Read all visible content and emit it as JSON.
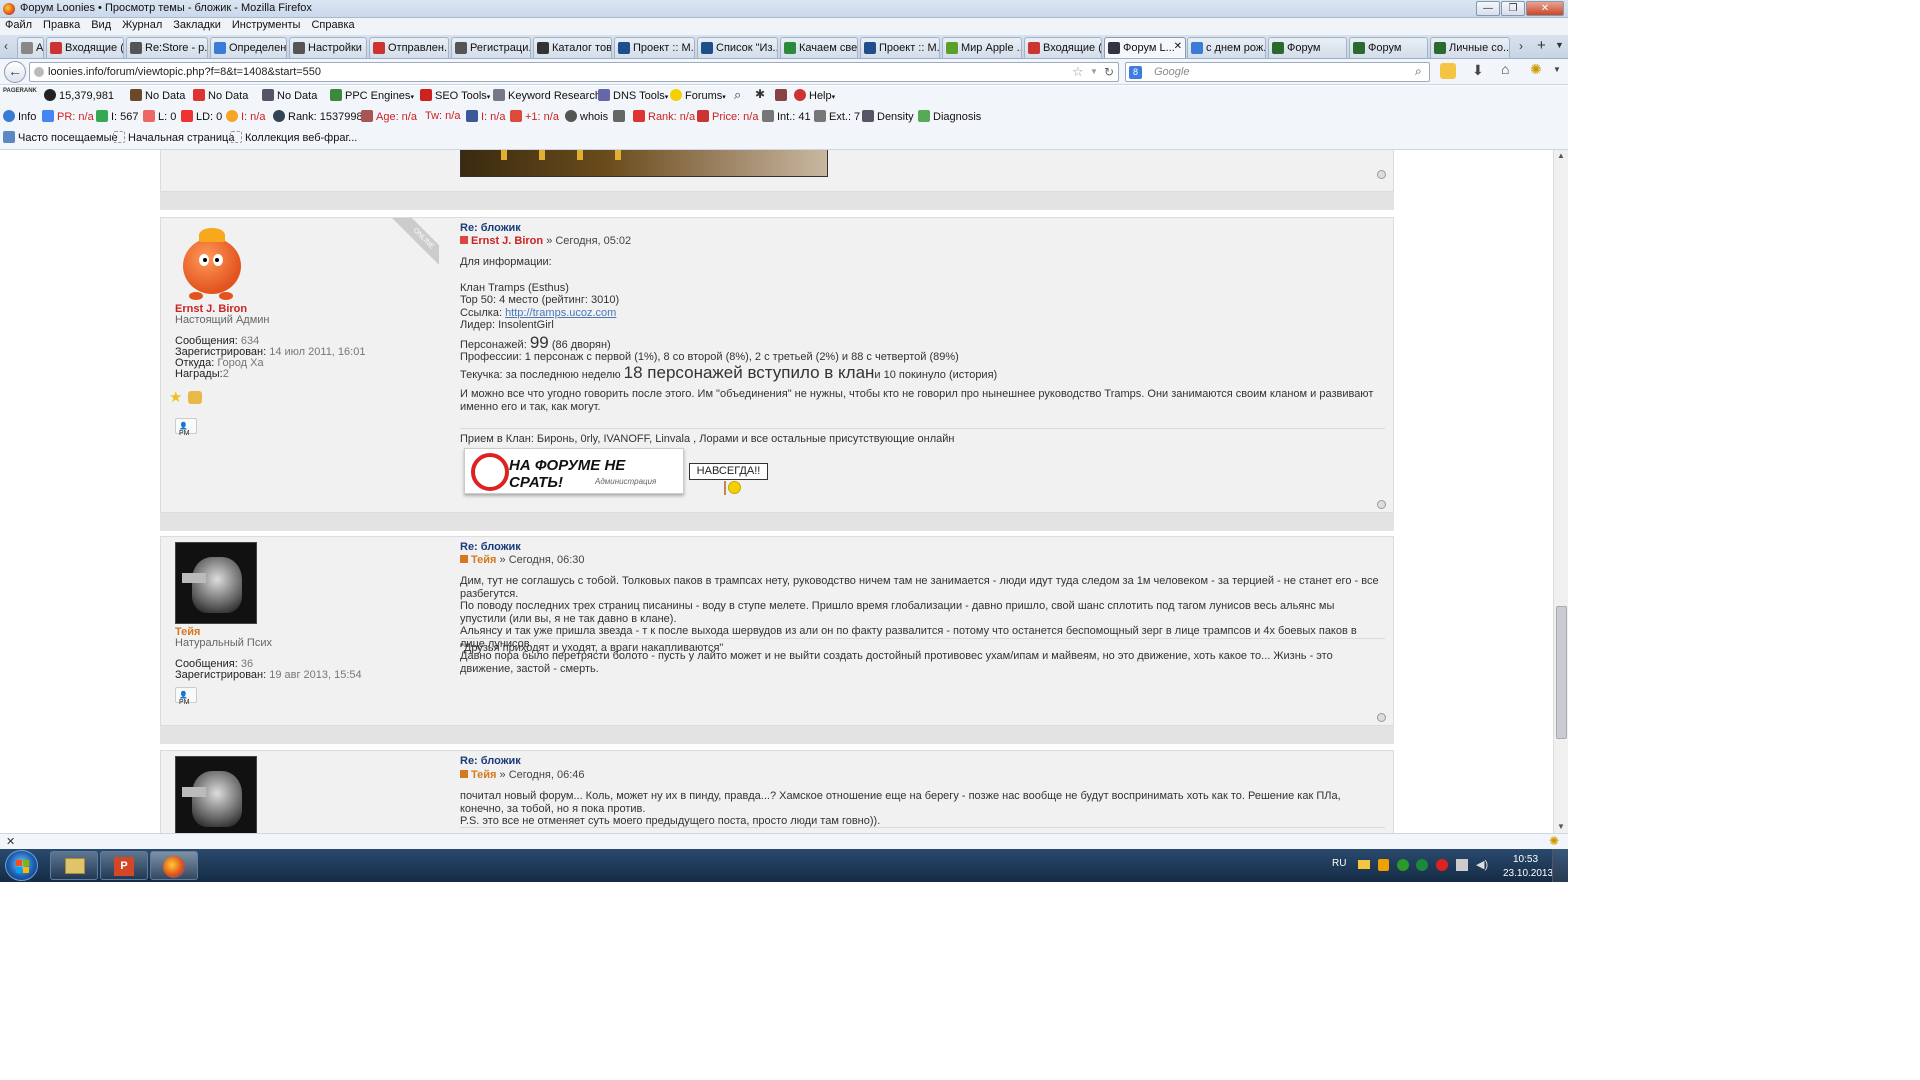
{
  "window": {
    "title": "Форум Loonies • Просмотр темы - бложик - Mozilla Firefox"
  },
  "menu": [
    "Файл",
    "Правка",
    "Вид",
    "Журнал",
    "Закладки",
    "Инструменты",
    "Справка"
  ],
  "tabs": [
    {
      "label": "Ad...",
      "icon_color": "#888"
    },
    {
      "label": "Входящие (...",
      "icon_color": "#c33"
    },
    {
      "label": "Re:Store - р...",
      "icon_color": "#555"
    },
    {
      "label": "Определен...",
      "icon_color": "#3a7bd5"
    },
    {
      "label": "Настройки ...",
      "icon_color": "#555"
    },
    {
      "label": "Отправлен...",
      "icon_color": "#c33"
    },
    {
      "label": "Регистраци...",
      "icon_color": "#555"
    },
    {
      "label": "Каталог тов...",
      "icon_color": "#333"
    },
    {
      "label": "Проект :: М...",
      "icon_color": "#1f4e8c"
    },
    {
      "label": "Список \"Из...",
      "icon_color": "#1f4e8c"
    },
    {
      "label": "Качаем све...",
      "icon_color": "#2b8a3e"
    },
    {
      "label": "Проект :: М...",
      "icon_color": "#1f4e8c"
    },
    {
      "label": "Мир Apple ...",
      "icon_color": "#5aa02c"
    },
    {
      "label": "Входящие (...",
      "icon_color": "#c33"
    },
    {
      "label": "Форум L...",
      "icon_color": "#334",
      "active": true
    },
    {
      "label": "с днем рож...",
      "icon_color": "#3a7bd5"
    },
    {
      "label": "Форум",
      "icon_color": "#2b6a2e"
    },
    {
      "label": "Форум",
      "icon_color": "#2b6a2e"
    },
    {
      "label": "Личные со...",
      "icon_color": "#2b6a2e"
    }
  ],
  "nav": {
    "url": "loonies.info/forum/viewtopic.php?f=8&t=1408&start=550",
    "search_placeholder": "Google"
  },
  "toolbar1": {
    "pagerank": "PAGERANK",
    "alexa": "15,379,981",
    "nodata1": "No Data",
    "nodata2": "No Data",
    "nodata3": "No Data",
    "ppc": "PPC Engines",
    "seo": "SEO Tools",
    "keyword": "Keyword Research",
    "dns": "DNS Tools",
    "forums": "Forums",
    "help": "Help"
  },
  "toolbar2": {
    "info": "Info",
    "pr": "PR: n/a",
    "i567": "I: 567",
    "l0": "L: 0",
    "ld0": "LD: 0",
    "ina": "I: n/a",
    "rank": "Rank: 15379981",
    "age": "Age: n/a",
    "tw": "Tw: n/a",
    "fb": "I: n/a",
    "gplus": "+1: n/a",
    "whois": "whois",
    "rank2": "Rank: n/a",
    "price": "Price: n/a",
    "int": "Int.: 41",
    "ext": "Ext.: 7",
    "density": "Density",
    "diagnosis": "Diagnosis"
  },
  "bookmarks": [
    "Часто посещаемые",
    "Начальная страница",
    "Коллекция веб-фраг..."
  ],
  "posts": [
    {
      "title": "Re: бложик",
      "author": "Ernst J. Biron",
      "date": "» Сегодня, 05:02",
      "online_badge": "ONLINE",
      "user_rank": "Настоящий Админ",
      "info": {
        "posts_label": "Сообщения:",
        "posts": "634",
        "reg_label": "Зарегистрирован:",
        "reg": "14 июл 2011, 16:01",
        "from_label": "Откуда:",
        "from": "Город Ха",
        "awards_label": "Награды:",
        "awards": "2"
      },
      "pm": "PM",
      "body": {
        "l1": "Для информации:",
        "l2": "Клан Tramps (Esthus)",
        "l3": "Top 50: 4 место (рейтинг: 3010)",
        "l4_label": "Ссылка:",
        "l4_link": "http://tramps.ucoz.com",
        "l5": "Лидер: InsolentGirl",
        "l6_label": "Персонажей:",
        "l6_big": "99",
        "l6_tail": "(86 дворян)",
        "l7": "Профессии: 1 персонаж с первой (1%), 8 со второй (8%), 2 с третьей (2%) и 88 с четвертой (89%)",
        "l8_label": "Текучка: за последнюю неделю",
        "l8_big": "18 персонажей вступило в клан",
        "l8_tail": "и 10 покинуло (история)",
        "l9": "И можно все что угодно говорить после этого. Им \"объединения\" не нужны, чтобы кто не говорил про нынешнее руководство Tramps. Они занимаются своим кланом и развивают именно его и так, как могут.",
        "sig": "Прием в Клан: Биронь, 0rly, IVANOFF, Linvala , Лорами и все остальные присутствующие онлайн",
        "banner": "НА ФОРУМЕ НЕ СРАТЬ!",
        "banner_sub": "Администрация",
        "sign": "НАВСЕГДА!!"
      }
    },
    {
      "title": "Re: бложик",
      "author": "Тейя",
      "date": "» Сегодня, 06:30",
      "user_rank": "Натуральный Псих",
      "info": {
        "posts_label": "Сообщения:",
        "posts": "36",
        "reg_label": "Зарегистрирован:",
        "reg": "19 авг 2013, 15:54"
      },
      "pm": "PM",
      "body": {
        "l1": "Дим, тут не соглашусь с тобой. Толковых паков в трампсах нету, руководство ничем там не занимается - люди идут туда следом за 1м человеком - за терцией - не станет его - все разбегутся.",
        "l2": "По поводу последних трех страниц писанины - воду в ступе мелете. Пришло время глобализации - давно пришло, свой шанс сплотить под тагом лунисов весь альянс мы упустили (или вы, я не так давно в клане).",
        "l3": "Альянсу и так уже пришла звезда - т к после выхода шервудов из али он по факту развалится - потому что останется беспомощный зерг в лице трампсов и 4х боевых паков в лице лунисов.",
        "l4": "Давно пора было перетрясти болото - пусть у лайто может и не выйти создать достойный противовес ухам/ипам и майвеям, но это движение, хоть какое то... Жизнь - это движение, застой - смерть.",
        "sig": "\"Друзья приходят и уходят, а враги накапливаются\""
      }
    },
    {
      "title": "Re: бложик",
      "author": "Тейя",
      "date": "» Сегодня, 06:46",
      "body": {
        "l1": "почитал новый форум... Коль, может ну их в пинду, правда...? Хамское отношение еще на берегу - позже нас вообще не будут воспринимать хоть как то. Решение как ПЛа, конечно, за тобой, но я пока против.",
        "l2": "P.S. это все не отменяет суть моего предыдущего поста, просто люди там говно))."
      }
    }
  ],
  "taskbar": {
    "lang": "RU",
    "time": "10:53",
    "date": "23.10.2013"
  }
}
